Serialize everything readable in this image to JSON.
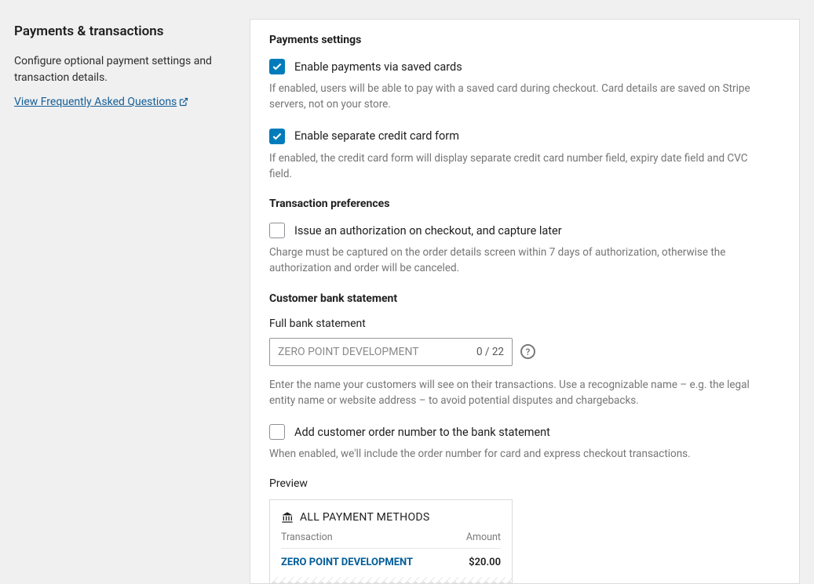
{
  "sidebar": {
    "title": "Payments & transactions",
    "description": "Configure optional payment settings and transaction details.",
    "faq_label": "View Frequently Asked Questions"
  },
  "sections": {
    "payments_settings": {
      "heading": "Payments settings",
      "saved_cards": {
        "label": "Enable payments via saved cards",
        "checked": true,
        "help": "If enabled, users will be able to pay with a saved card during checkout. Card details are saved on Stripe servers, not on your store."
      },
      "separate_form": {
        "label": "Enable separate credit card form",
        "checked": true,
        "help": "If enabled, the credit card form will display separate credit card number field, expiry date field and CVC field."
      }
    },
    "transaction_prefs": {
      "heading": "Transaction preferences",
      "auth_capture": {
        "label": "Issue an authorization on checkout, and capture later",
        "checked": false,
        "help": "Charge must be captured on the order details screen within 7 days of authorization, otherwise the authorization and order will be canceled."
      }
    },
    "bank_statement": {
      "heading": "Customer bank statement",
      "full_label": "Full bank statement",
      "placeholder": "ZERO POINT DEVELOPMENT",
      "counter": "0 / 22",
      "help": "Enter the name your customers will see on their transactions. Use a recognizable name – e.g. the legal entity name or website address – to avoid potential disputes and chargebacks.",
      "order_number": {
        "label": "Add customer order number to the bank statement",
        "checked": false,
        "help": "When enabled, we'll include the order number for card and express checkout transactions."
      }
    },
    "preview": {
      "heading": "Preview",
      "card_title": "ALL PAYMENT METHODS",
      "col_transaction": "Transaction",
      "col_amount": "Amount",
      "merchant": "ZERO POINT DEVELOPMENT",
      "amount": "$20.00"
    }
  }
}
